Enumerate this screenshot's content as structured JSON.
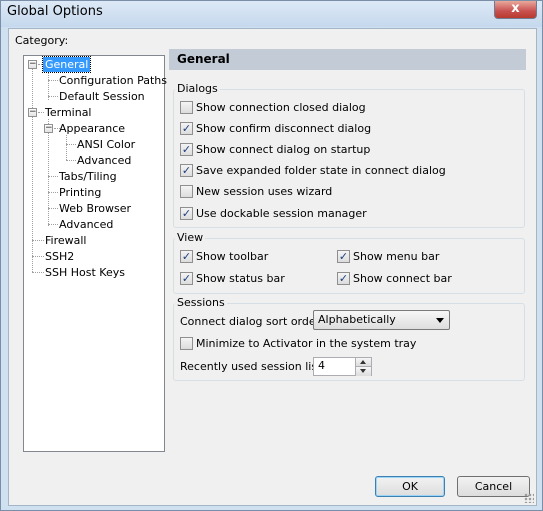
{
  "window": {
    "title": "Global Options",
    "close_glyph": "x"
  },
  "category": {
    "label": "Category:"
  },
  "tree": {
    "items": [
      {
        "label": "General",
        "expanded": true,
        "selected": true
      },
      {
        "label": "Configuration Paths"
      },
      {
        "label": "Default Session"
      },
      {
        "label": "Terminal",
        "expanded": true
      },
      {
        "label": "Appearance",
        "expanded": true
      },
      {
        "label": "ANSI Color"
      },
      {
        "label": "Advanced"
      },
      {
        "label": "Tabs/Tiling"
      },
      {
        "label": "Printing"
      },
      {
        "label": "Web Browser"
      },
      {
        "label": "Advanced"
      },
      {
        "label": "Firewall"
      },
      {
        "label": "SSH2"
      },
      {
        "label": "SSH Host Keys"
      }
    ]
  },
  "panel": {
    "title": "General"
  },
  "dialogs": {
    "label": "Dialogs",
    "options": [
      {
        "label": "Show connection closed dialog",
        "checked": false
      },
      {
        "label": "Show confirm disconnect dialog",
        "checked": true
      },
      {
        "label": "Show connect dialog on startup",
        "checked": true
      },
      {
        "label": "Save expanded folder state in connect dialog",
        "checked": true
      },
      {
        "label": "New session uses wizard",
        "checked": false
      },
      {
        "label": "Use dockable session manager",
        "checked": true
      }
    ]
  },
  "view": {
    "label": "View",
    "options": [
      {
        "label": "Show toolbar",
        "checked": true
      },
      {
        "label": "Show menu bar",
        "checked": true
      },
      {
        "label": "Show status bar",
        "checked": true
      },
      {
        "label": "Show connect bar",
        "checked": true
      }
    ]
  },
  "sessions": {
    "label": "Sessions",
    "sort_order_label": "Connect dialog sort order:",
    "sort_order_value": "Alphabetically",
    "minimize_label": "Minimize to Activator in the system tray",
    "minimize_checked": false,
    "recent_label": "Recently used session list:",
    "recent_value": "4"
  },
  "buttons": {
    "ok": "OK",
    "cancel": "Cancel"
  },
  "check_glyph": "✓",
  "colors": {
    "selection": "#3399ff",
    "header_bar": "#c3cbd7",
    "frame": "#cfe0f1"
  }
}
